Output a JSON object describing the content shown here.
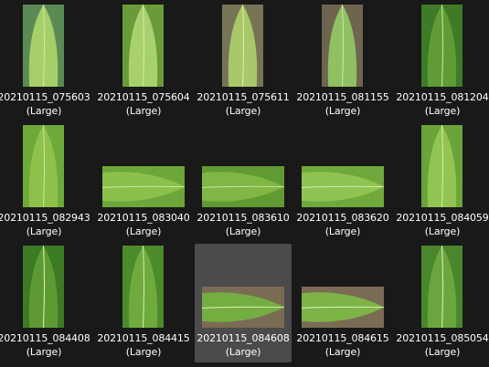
{
  "view": "large-icons",
  "size_label": "(Large)",
  "files": [
    {
      "name": "20210115_075603",
      "orientation": "portrait",
      "palette": [
        "#6a9a3a",
        "#a6cf6a",
        "#cfe89a",
        "#2f5ea8"
      ],
      "selected": false
    },
    {
      "name": "20210115_075604",
      "orientation": "portrait",
      "palette": [
        "#6a9a3a",
        "#a8d06c",
        "#d2ea9e",
        "#2f5ea8"
      ],
      "selected": false
    },
    {
      "name": "20210115_075611",
      "orientation": "portrait",
      "palette": [
        "#7a7a5a",
        "#a8c86a",
        "#d8eda4",
        "#6b6448"
      ],
      "selected": false
    },
    {
      "name": "20210115_081155",
      "orientation": "portrait",
      "palette": [
        "#6e6450",
        "#8fc062",
        "#c8e6a2",
        "#7a6e58"
      ],
      "selected": false
    },
    {
      "name": "20210115_081204",
      "orientation": "portrait",
      "palette": [
        "#3f7a26",
        "#5f9c36",
        "#c7e3a0",
        "#3f7a26"
      ],
      "selected": false
    },
    {
      "name": "20210115_082943",
      "orientation": "portrait",
      "palette": [
        "#6eaa3a",
        "#8fc04c",
        "#c8e39a",
        "#6eaa3a"
      ],
      "selected": false
    },
    {
      "name": "20210115_083040",
      "orientation": "landscape",
      "palette": [
        "#6da63a",
        "#8cc04c",
        "#c9e49e",
        "#6da63a"
      ],
      "selected": false
    },
    {
      "name": "20210115_083610",
      "orientation": "landscape",
      "palette": [
        "#5f9a32",
        "#7fb644",
        "#c4e096",
        "#5f9a32"
      ],
      "selected": false
    },
    {
      "name": "20210115_083620",
      "orientation": "landscape",
      "palette": [
        "#6fa83c",
        "#90c452",
        "#cfe8a6",
        "#6fa83c"
      ],
      "selected": false
    },
    {
      "name": "20210115_084059",
      "orientation": "portrait",
      "palette": [
        "#6aa43a",
        "#92c452",
        "#d2ea9e",
        "#6aa43a"
      ],
      "selected": false
    },
    {
      "name": "20210115_084408",
      "orientation": "portrait",
      "palette": [
        "#3d7a24",
        "#5e9a34",
        "#d8eeb0",
        "#3d7a24"
      ],
      "selected": false
    },
    {
      "name": "20210115_084415",
      "orientation": "portrait",
      "palette": [
        "#4c8a2c",
        "#6eaa3e",
        "#cfe8a4",
        "#4c8a2c"
      ],
      "selected": false
    },
    {
      "name": "20210115_084608",
      "orientation": "landscape",
      "palette": [
        "#7a6c54",
        "#74ae42",
        "#d4ecb0",
        "#8a7a60"
      ],
      "selected": true
    },
    {
      "name": "20210115_084615",
      "orientation": "landscape",
      "palette": [
        "#7a6c54",
        "#7db446",
        "#d6eeb2",
        "#8a7a60"
      ],
      "selected": false
    },
    {
      "name": "20210115_085054",
      "orientation": "portrait",
      "palette": [
        "#4a862c",
        "#6aa63e",
        "#d6ecb0",
        "#4a862c"
      ],
      "selected": false
    }
  ]
}
